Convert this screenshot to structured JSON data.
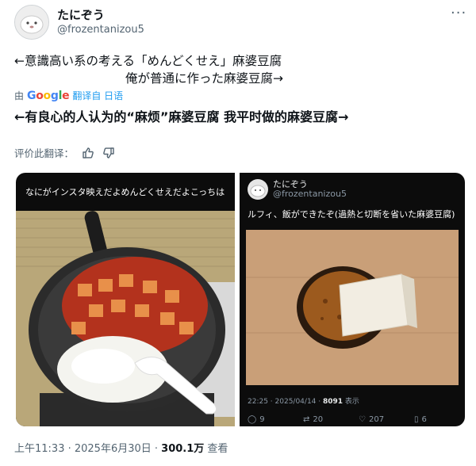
{
  "header": {
    "display_name": "たにぞう",
    "handle": "@frozentanizou5",
    "more_icon": "ellipsis-icon"
  },
  "post": {
    "line1": "←意識高い系の考える「めんどくせえ」麻婆豆腐",
    "line2": "俺が普通に作った麻婆豆腐→"
  },
  "translation": {
    "prefix": "由",
    "google_letters": [
      "G",
      "o",
      "o",
      "g",
      "l",
      "e"
    ],
    "translated_from": "翻译自 日语",
    "text": "←有良心的人认为的“麻烦”麻婆豆腐 我平时做的麻婆豆腐→",
    "rate_label": "评价此翻译："
  },
  "media_left": {
    "caption": "なにがインスタ映えだよめんどくせえだよこっちは"
  },
  "media_right": {
    "display_name": "たにぞう",
    "handle": "@frozentanizou5",
    "caption": "ルフィ、飯ができたぞ(過熱と切断を省いた麻婆豆腐)",
    "time": "22:25 · 2025/04/14 · ",
    "views_count": "8091",
    "views_label": "表示",
    "actions": {
      "reply": "9",
      "retweet": "20",
      "like": "207",
      "bookmark": "6"
    }
  },
  "footer": {
    "time": "上午11:33 · 2025年6月30日 · ",
    "views_count": "300.1万",
    "views_label": " 查看"
  },
  "colors": {
    "link": "#1d9bf0",
    "muted": "#536471",
    "text": "#0f1419",
    "media_bg": "#0c0c0c"
  }
}
